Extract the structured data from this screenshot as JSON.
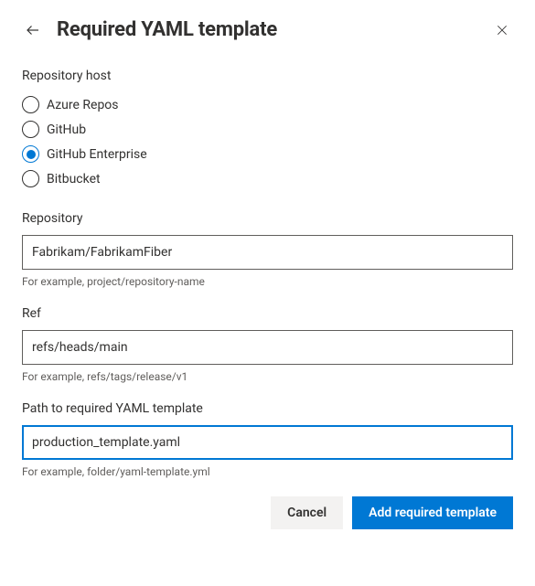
{
  "header": {
    "title": "Required YAML template"
  },
  "repository_host": {
    "label": "Repository host",
    "options": [
      {
        "label": "Azure Repos",
        "selected": false
      },
      {
        "label": "GitHub",
        "selected": false
      },
      {
        "label": "GitHub Enterprise",
        "selected": true
      },
      {
        "label": "Bitbucket",
        "selected": false
      }
    ]
  },
  "repository": {
    "label": "Repository",
    "value": "Fabrikam/FabrikamFiber",
    "helper": "For example, project/repository-name"
  },
  "ref": {
    "label": "Ref",
    "value": "refs/heads/main",
    "helper": "For example, refs/tags/release/v1"
  },
  "path": {
    "label": "Path to required YAML template",
    "value": "production_template.yaml",
    "helper": "For example, folder/yaml-template.yml",
    "focused": true
  },
  "footer": {
    "cancel": "Cancel",
    "submit": "Add required template"
  }
}
